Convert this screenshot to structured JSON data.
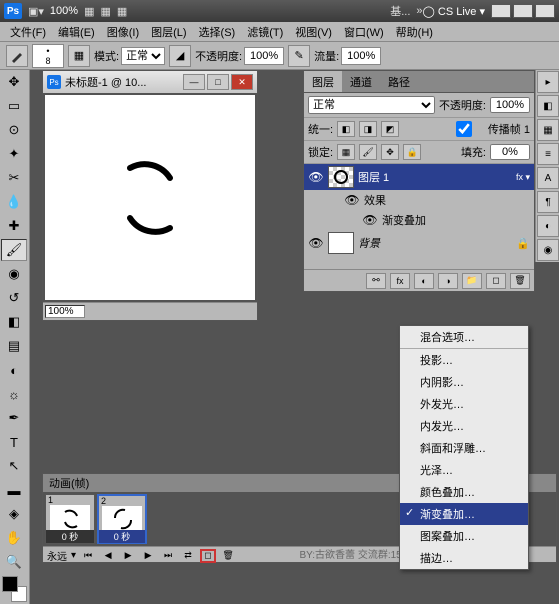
{
  "titlebar": {
    "ps_label": "Ps",
    "zoom_pct": "100%",
    "essentials": "基...",
    "cslive": "CS Live"
  },
  "menu": {
    "file": "文件(F)",
    "edit": "编辑(E)",
    "image": "图像(I)",
    "layer": "图层(L)",
    "select": "选择(S)",
    "filter": "滤镜(T)",
    "view": "视图(V)",
    "window": "窗口(W)",
    "help": "帮助(H)"
  },
  "optbar": {
    "brush_size": "8",
    "mode_label": "模式:",
    "mode_value": "正常",
    "opacity_label": "不透明度:",
    "opacity_value": "100%",
    "flow_label": "流量:",
    "flow_value": "100%"
  },
  "doc": {
    "title": "未标题-1 @ 10...",
    "zoom": "100%"
  },
  "layers": {
    "tabs": {
      "layers": "图层",
      "channels": "通道",
      "paths": "路径"
    },
    "blend_mode": "正常",
    "opacity_label": "不透明度:",
    "opacity_value": "100%",
    "unify_label": "统一:",
    "propagate": "传播帧 1",
    "lock_label": "锁定:",
    "fill_label": "填充:",
    "fill_value": "0%",
    "items": [
      {
        "name": "图层 1"
      },
      {
        "name": "效果"
      },
      {
        "name": "渐变叠加"
      },
      {
        "name": "背景"
      }
    ]
  },
  "fx_menu": {
    "blend_opts": "混合选项",
    "drop_shadow": "投影",
    "inner_shadow": "内阴影",
    "outer_glow": "外发光",
    "inner_glow": "内发光",
    "bevel": "斜面和浮雕",
    "satin": "光泽",
    "color_overlay": "颜色叠加",
    "gradient_overlay": "渐变叠加",
    "pattern_overlay": "图案叠加",
    "stroke": "描边"
  },
  "anim": {
    "title": "动画(帧)",
    "frames": [
      {
        "num": "1",
        "time": "0 秒"
      },
      {
        "num": "2",
        "time": "0 秒"
      }
    ],
    "loop": "永远"
  },
  "watermark": "BY:古欲香蕾  交流群:15518....  百度photoshop贴吧"
}
